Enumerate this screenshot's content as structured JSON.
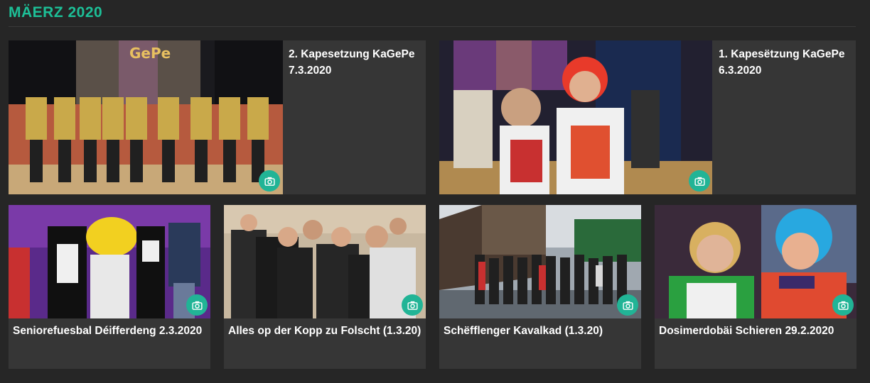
{
  "section": {
    "title": "MÄERZ 2020"
  },
  "colors": {
    "accent": "#1dbf97",
    "background": "#262626",
    "card": "#363636"
  },
  "icons": {
    "gallery": "camera-icon"
  },
  "cards": [
    {
      "title": "2. Kapesetzung KaGePe 7.3.2020"
    },
    {
      "title": "1. Kapesëtzung KaGePe 6.3.2020"
    },
    {
      "title": "Seniorefuesbal Déifferdeng 2.3.2020"
    },
    {
      "title": "Alles op der Kopp zu Folscht (1.3.20)"
    },
    {
      "title": "Schëfflenger Kavalkad (1.3.20)"
    },
    {
      "title": "Dosimerdobäi Schieren 29.2.2020"
    }
  ]
}
